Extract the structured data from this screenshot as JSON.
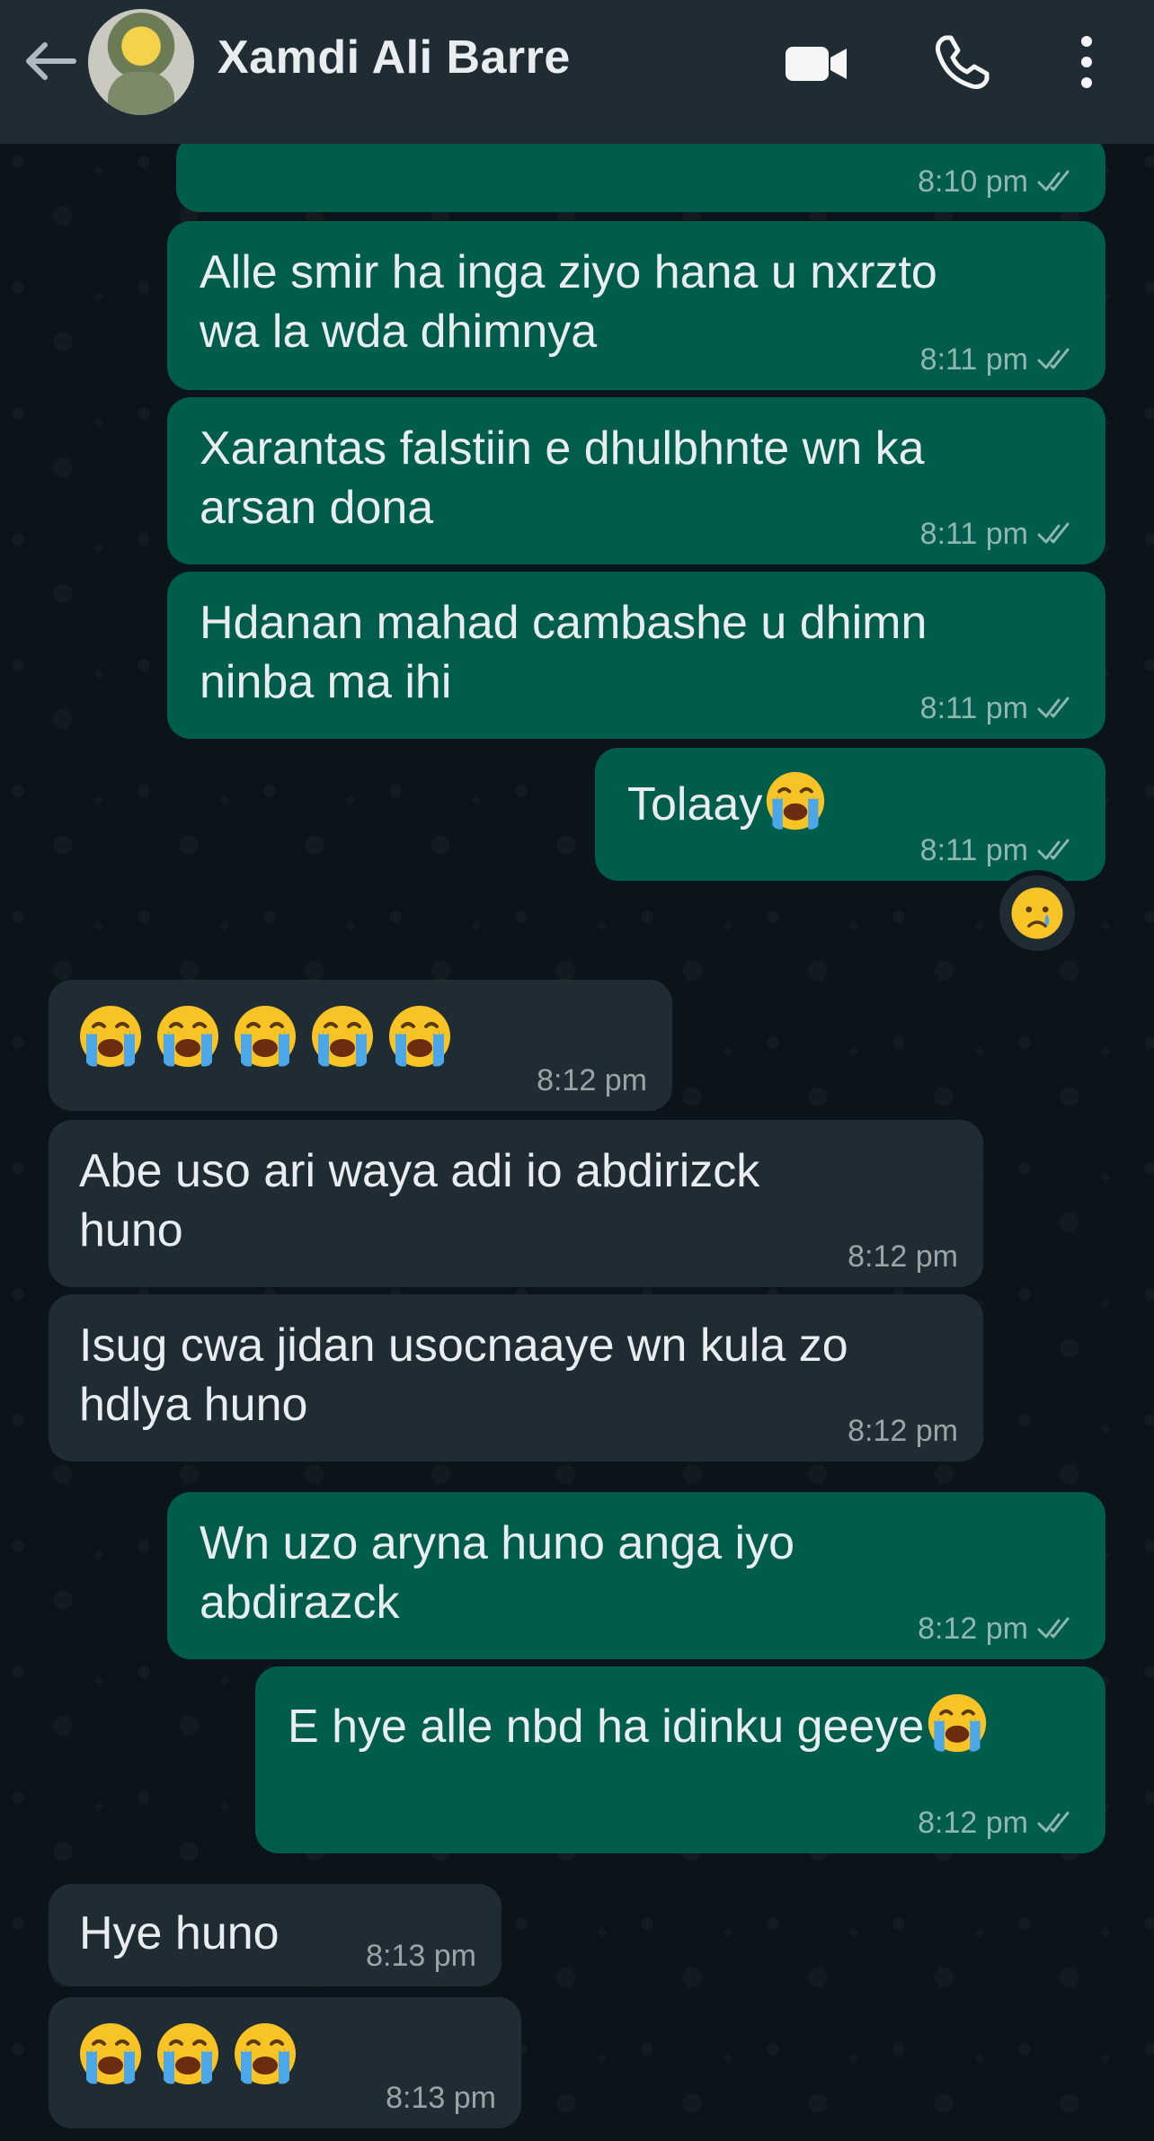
{
  "header": {
    "contact_name": "Xamdi Ali Barre",
    "icons": [
      "back-arrow-icon",
      "video-call-icon",
      "voice-call-icon",
      "more-options-icon"
    ]
  },
  "messages": [
    {
      "direction": "out",
      "text": "",
      "time": "8:10 pm",
      "status": "read"
    },
    {
      "direction": "out",
      "text": "Alle smir ha inga ziyo hana u nxrzto\nwa la wda dhimnya",
      "time": "8:11 pm",
      "status": "read"
    },
    {
      "direction": "out",
      "text": "Xarantas falstiin e dhulbhnte wn ka\narsan dona",
      "time": "8:11 pm",
      "status": "read"
    },
    {
      "direction": "out",
      "text": "Hdanan mahad cambashe u dhimn\nninba ma ihi",
      "time": "8:11 pm",
      "status": "read"
    },
    {
      "direction": "out",
      "text": "Tolaay",
      "emoji": "loudly-crying-face",
      "time": "8:11 pm",
      "status": "read",
      "reaction": "crying-face"
    },
    {
      "direction": "in",
      "emoji_count": 5,
      "emoji": "loudly-crying-face",
      "time": "8:12 pm"
    },
    {
      "direction": "in",
      "text": "Abe uso ari waya adi io abdirizck\nhuno",
      "time": "8:12 pm"
    },
    {
      "direction": "in",
      "text": "Isug cwa jidan usocnaaye wn kula zo\nhdlya huno",
      "time": "8:12 pm"
    },
    {
      "direction": "out",
      "text": "Wn uzo aryna huno anga iyo\nabdirazck",
      "time": "8:12 pm",
      "status": "read"
    },
    {
      "direction": "out",
      "text": "E hye alle nbd ha idinku geeye",
      "emoji": "loudly-crying-face",
      "time": "8:12 pm",
      "status": "read"
    },
    {
      "direction": "in",
      "text": "Hye huno",
      "time": "8:13 pm"
    },
    {
      "direction": "in",
      "emoji_count": 3,
      "emoji": "loudly-crying-face",
      "time": "8:13 pm"
    }
  ],
  "colors": {
    "background": "#0b141a",
    "header": "#202c33",
    "outgoing_bubble": "#005c4b",
    "incoming_bubble": "#202c33",
    "text": "#e9edef"
  }
}
